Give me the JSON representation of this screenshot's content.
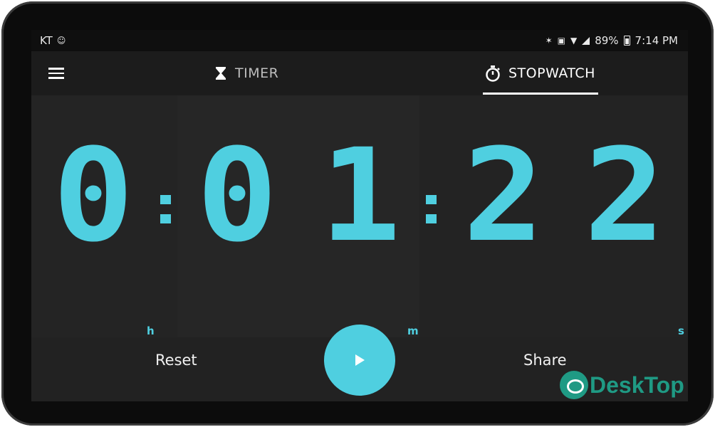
{
  "statusbar": {
    "carrier": "KT",
    "battery": "89%",
    "time": "7:14 PM"
  },
  "toolbar": {
    "tabs": [
      {
        "label": "TIMER",
        "icon": "hourglass-icon",
        "selected": false
      },
      {
        "label": "STOPWATCH",
        "icon": "stopwatch-icon",
        "selected": true
      }
    ]
  },
  "stopwatch": {
    "hours": "0",
    "minutes_tens": "0",
    "minutes_ones": "1",
    "seconds_tens": "2",
    "seconds_ones": "2",
    "sep1": ":",
    "sep2": ":",
    "unit_h": "h",
    "unit_m": "m",
    "unit_s": "s"
  },
  "actions": {
    "reset_label": "Reset",
    "share_label": "Share",
    "play_icon": "play-icon"
  },
  "watermark": {
    "text": "DeskTop"
  },
  "colors": {
    "accent": "#4fcfe0",
    "background": "#222222",
    "toolbar": "#1c1c1c"
  }
}
